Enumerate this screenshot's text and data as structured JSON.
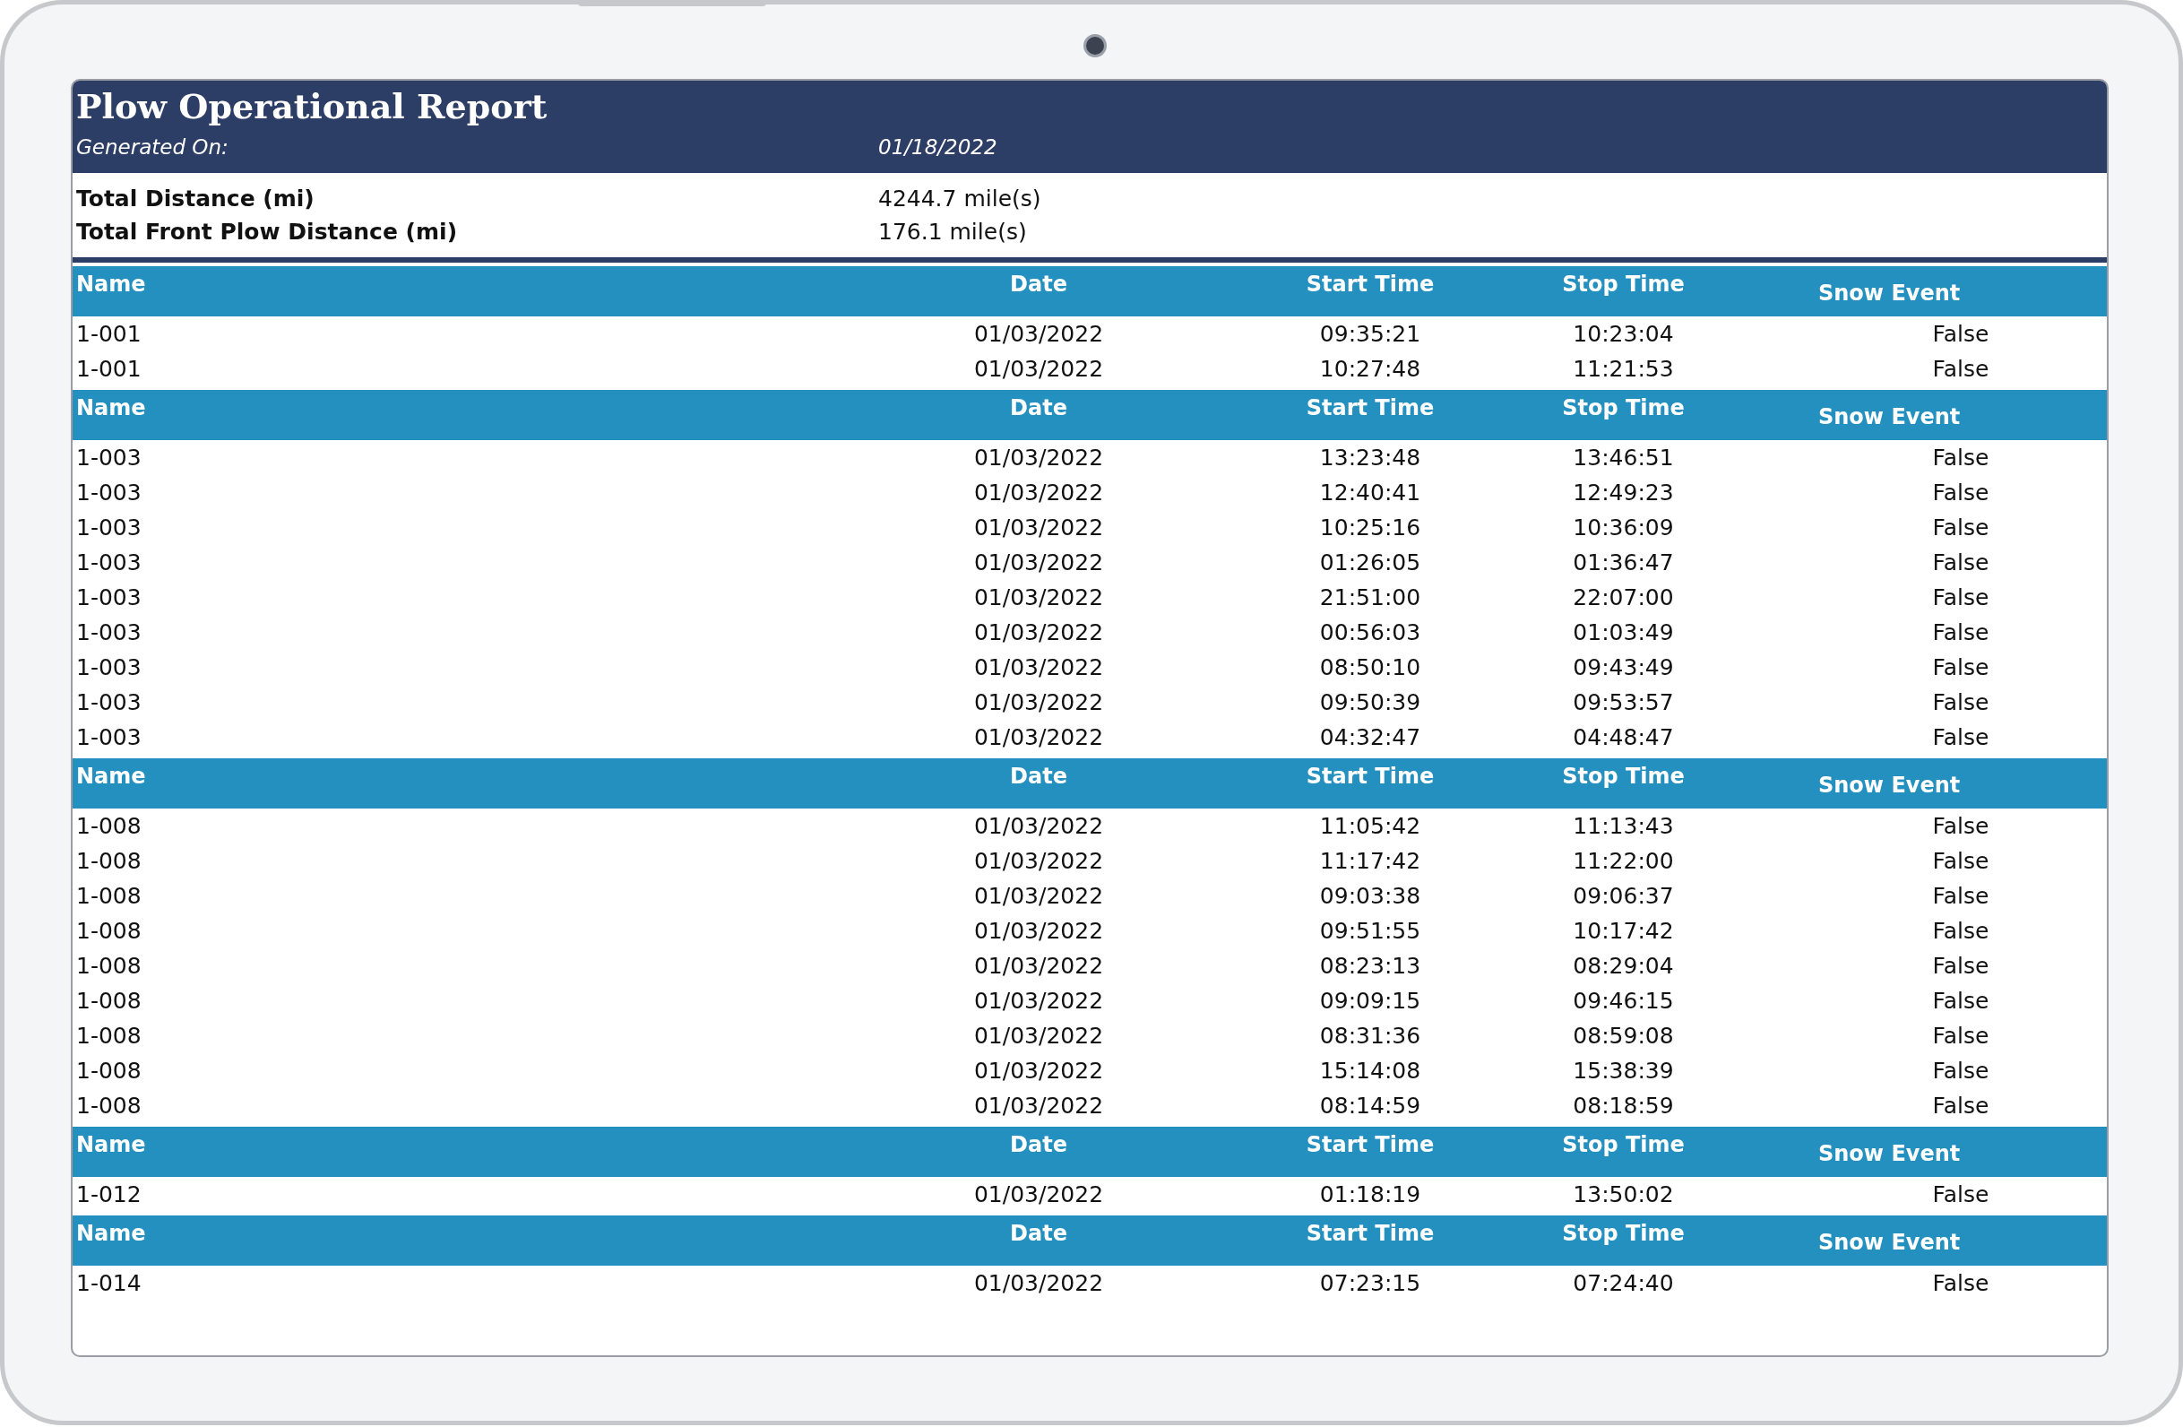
{
  "report": {
    "title": "Plow Operational Report",
    "generated_label": "Generated On:",
    "generated_value": "01/18/2022",
    "summary": [
      {
        "label": "Total Distance (mi)",
        "value": "4244.7 mile(s)"
      },
      {
        "label": "Total Front Plow Distance (mi)",
        "value": "176.1 mile(s)"
      }
    ],
    "groups": [
      {
        "columns": [
          "Name",
          "Date",
          "Start Time",
          "Stop Time",
          "Snow Event"
        ],
        "rows": [
          [
            "1-001",
            "01/03/2022",
            "09:35:21",
            "10:23:04",
            "False"
          ],
          [
            "1-001",
            "01/03/2022",
            "10:27:48",
            "11:21:53",
            "False"
          ]
        ]
      },
      {
        "columns": [
          "Name",
          "Date",
          "Start Time",
          "Stop Time",
          "Snow Event"
        ],
        "rows": [
          [
            "1-003",
            "01/03/2022",
            "13:23:48",
            "13:46:51",
            "False"
          ],
          [
            "1-003",
            "01/03/2022",
            "12:40:41",
            "12:49:23",
            "False"
          ],
          [
            "1-003",
            "01/03/2022",
            "10:25:16",
            "10:36:09",
            "False"
          ],
          [
            "1-003",
            "01/03/2022",
            "01:26:05",
            "01:36:47",
            "False"
          ],
          [
            "1-003",
            "01/03/2022",
            "21:51:00",
            "22:07:00",
            "False"
          ],
          [
            "1-003",
            "01/03/2022",
            "00:56:03",
            "01:03:49",
            "False"
          ],
          [
            "1-003",
            "01/03/2022",
            "08:50:10",
            "09:43:49",
            "False"
          ],
          [
            "1-003",
            "01/03/2022",
            "09:50:39",
            "09:53:57",
            "False"
          ],
          [
            "1-003",
            "01/03/2022",
            "04:32:47",
            "04:48:47",
            "False"
          ]
        ]
      },
      {
        "columns": [
          "Name",
          "Date",
          "Start Time",
          "Stop Time",
          "Snow Event"
        ],
        "rows": [
          [
            "1-008",
            "01/03/2022",
            "11:05:42",
            "11:13:43",
            "False"
          ],
          [
            "1-008",
            "01/03/2022",
            "11:17:42",
            "11:22:00",
            "False"
          ],
          [
            "1-008",
            "01/03/2022",
            "09:03:38",
            "09:06:37",
            "False"
          ],
          [
            "1-008",
            "01/03/2022",
            "09:51:55",
            "10:17:42",
            "False"
          ],
          [
            "1-008",
            "01/03/2022",
            "08:23:13",
            "08:29:04",
            "False"
          ],
          [
            "1-008",
            "01/03/2022",
            "09:09:15",
            "09:46:15",
            "False"
          ],
          [
            "1-008",
            "01/03/2022",
            "08:31:36",
            "08:59:08",
            "False"
          ],
          [
            "1-008",
            "01/03/2022",
            "15:14:08",
            "15:38:39",
            "False"
          ],
          [
            "1-008",
            "01/03/2022",
            "08:14:59",
            "08:18:59",
            "False"
          ]
        ]
      },
      {
        "columns": [
          "Name",
          "Date",
          "Start Time",
          "Stop Time",
          "Snow Event"
        ],
        "rows": [
          [
            "1-012",
            "01/03/2022",
            "01:18:19",
            "13:50:02",
            "False"
          ]
        ]
      },
      {
        "columns": [
          "Name",
          "Date",
          "Start Time",
          "Stop Time",
          "Snow Event"
        ],
        "rows": [
          [
            "1-014",
            "01/03/2022",
            "07:23:15",
            "07:24:40",
            "False"
          ]
        ]
      }
    ]
  }
}
